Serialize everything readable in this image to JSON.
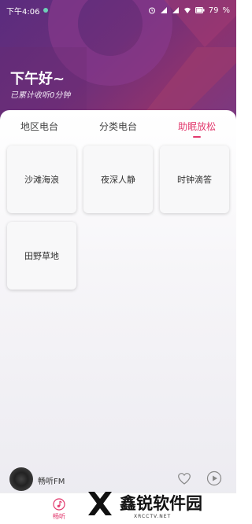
{
  "status_bar": {
    "time": "下午4:06",
    "battery": "79"
  },
  "header": {
    "greeting": "下午好~",
    "listen_info": "已累计收听0分钟"
  },
  "tabs": [
    {
      "label": "地区电台",
      "active": false
    },
    {
      "label": "分类电台",
      "active": false
    },
    {
      "label": "助眠放松",
      "active": true
    }
  ],
  "cards": [
    {
      "label": "沙滩海浪"
    },
    {
      "label": "夜深人静"
    },
    {
      "label": "时钟滴答"
    },
    {
      "label": "田野草地"
    }
  ],
  "player": {
    "title": "畅听FM"
  },
  "bottom_nav": {
    "items": [
      {
        "label": "畅听",
        "icon": "music-note-icon",
        "active": true
      }
    ]
  },
  "watermark": {
    "text": "鑫锐软件园",
    "sub": "XRCCTV.NET"
  },
  "colors": {
    "accent": "#e23a6e",
    "header_start": "#5a2c7e",
    "header_end": "#8a3270"
  }
}
